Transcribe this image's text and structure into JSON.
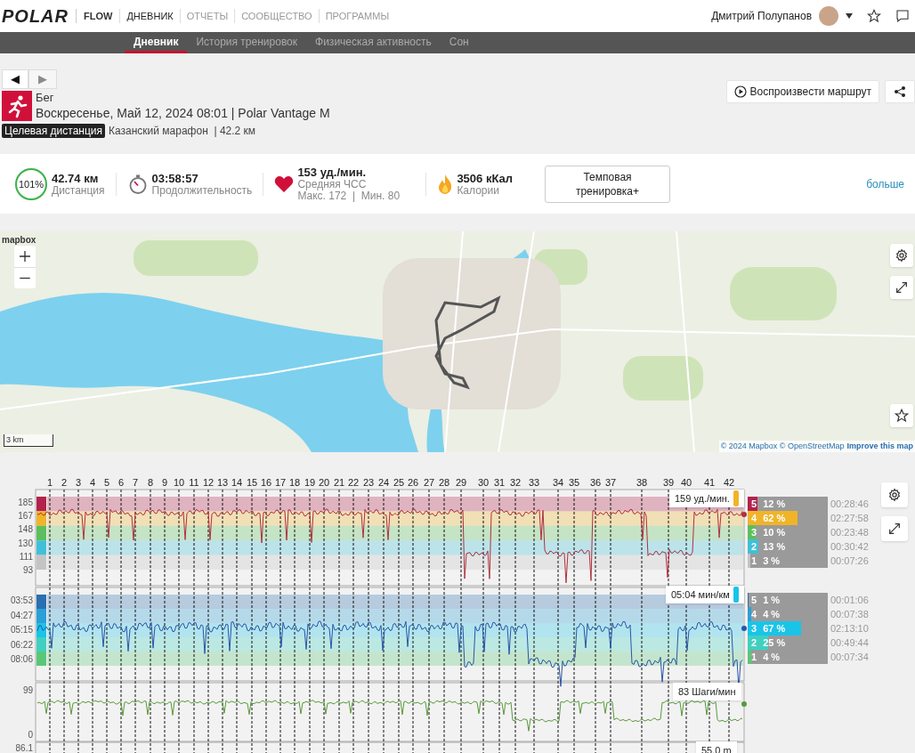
{
  "nav": {
    "logo": "POLAR",
    "brand": "FLOW",
    "tabs": [
      {
        "label": "ДНЕВНИК",
        "selected": true
      },
      {
        "label": "ОТЧЕТЫ",
        "selected": false
      },
      {
        "label": "СООБЩЕСТВО",
        "selected": false
      },
      {
        "label": "ПРОГРАММЫ",
        "selected": false
      }
    ],
    "user": "Дмитрий Полупанов"
  },
  "subnav": [
    {
      "label": "Дневник",
      "selected": true
    },
    {
      "label": "История тренировок",
      "selected": false
    },
    {
      "label": "Физическая активность",
      "selected": false
    },
    {
      "label": "Сон",
      "selected": false
    }
  ],
  "pager": {
    "prev": "◀",
    "next": "▶",
    "next_disabled": true
  },
  "session": {
    "sport": "Бег",
    "datetime": "Воскресенье, Май 12, 2024 08:01 | Polar Vantage M",
    "target_badge": "Целевая дистанция",
    "target": "Казанский марафон  | 42.2 км"
  },
  "actions": {
    "replay": "Воспроизвести маршрут"
  },
  "summary": {
    "distance": {
      "value": "42.74 км",
      "label": "Дистанция",
      "percent": "101%",
      "level": 1
    },
    "duration": {
      "value": "03:58:57",
      "label": "Продолжительность"
    },
    "heart_rate": {
      "value": "153 уд./мин.",
      "label": "Средняя ЧСС",
      "detail": "Макс. 172  |  Мин. 80"
    },
    "calories": {
      "value": "3506 кКал",
      "label": "Калории"
    },
    "training_benefit": "Темповая тренировка+",
    "more": "больше"
  },
  "map": {
    "brand": "mapbox",
    "scale": "3 km",
    "attribution": "© 2024 Mapbox © OpenStreetMap",
    "improve_link": "Improve this map"
  },
  "laps": [
    "1",
    "2",
    "3",
    "4",
    "5",
    "6",
    "7",
    "8",
    "9",
    "10",
    "11",
    "12",
    "13",
    "14",
    "15",
    "16",
    "17",
    "18",
    "19",
    "20",
    "21",
    "22",
    "23",
    "24",
    "25",
    "26",
    "27",
    "28",
    "29",
    "30",
    "31",
    "32",
    "33",
    "34",
    "35",
    "36",
    "37",
    "38",
    "39",
    "40",
    "41",
    "42"
  ],
  "charts": [
    {
      "kind": "heart_rate",
      "yticks": [
        "185",
        "167",
        "148",
        "130",
        "111",
        "93"
      ],
      "readout": "159 уд./мин.",
      "zones": [
        {
          "zone": "5",
          "share": "12 %",
          "level": 0.12,
          "time": "00:28:46",
          "color": "#b3224c"
        },
        {
          "zone": "4",
          "share": "62 %",
          "level": 0.62,
          "time": "02:27:58",
          "color": "#f0b429"
        },
        {
          "zone": "3",
          "share": "10 %",
          "level": 0.1,
          "time": "00:23:48",
          "color": "#5cbf5c"
        },
        {
          "zone": "2",
          "share": "13 %",
          "level": 0.13,
          "time": "00:30:42",
          "color": "#3fc0d8"
        },
        {
          "zone": "1",
          "share": "3 %",
          "level": 0.03,
          "time": "00:07:26",
          "color": "#c4c4c4"
        }
      ]
    },
    {
      "kind": "pace",
      "yticks": [
        "03:53",
        "04:27",
        "05:15",
        "06:22",
        "08:06"
      ],
      "readout": "05:04 мин/км",
      "zones": [
        {
          "zone": "5",
          "share": "1 %",
          "level": 0.01,
          "time": "00:01:06",
          "color": "#2a6fb0"
        },
        {
          "zone": "4",
          "share": "4 %",
          "level": 0.04,
          "time": "00:07:38",
          "color": "#2a9fd8"
        },
        {
          "zone": "3",
          "share": "67 %",
          "level": 0.67,
          "time": "02:13:10",
          "color": "#19c4e8"
        },
        {
          "zone": "2",
          "share": "25 %",
          "level": 0.25,
          "time": "00:49:44",
          "color": "#3fd0c0"
        },
        {
          "zone": "1",
          "share": "4 %",
          "level": 0.04,
          "time": "00:07:34",
          "color": "#58c878"
        }
      ]
    },
    {
      "kind": "cadence",
      "yticks": [
        "99",
        "0"
      ],
      "readout": "83 Шаги/мин"
    },
    {
      "kind": "altitude",
      "yticks": [
        "86.1"
      ],
      "readout": "55.0 m"
    }
  ]
}
